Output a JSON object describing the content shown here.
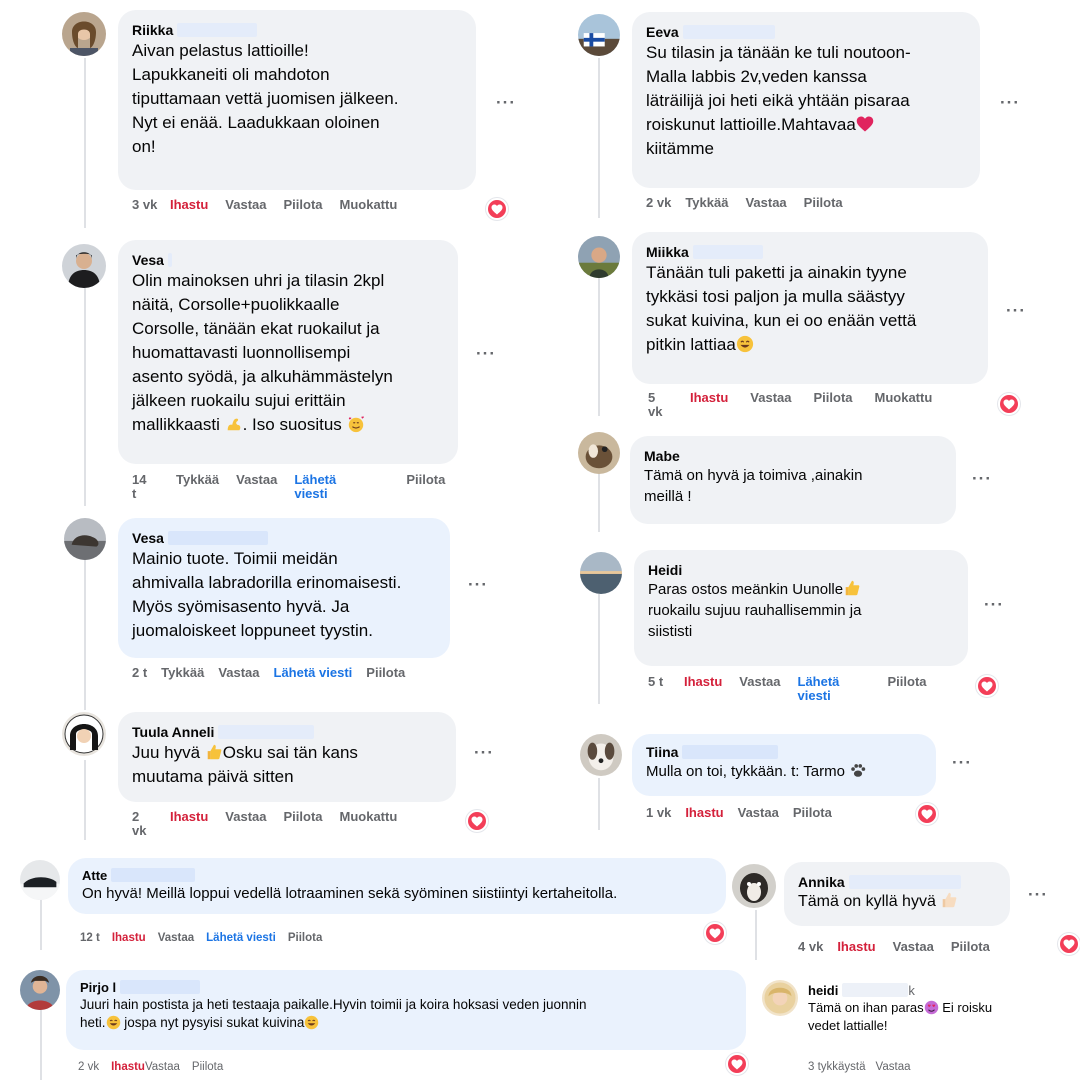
{
  "icons": {
    "more": "more-options-icon",
    "heart": "heart-reaction-icon"
  },
  "colors": {
    "love": "#d4213b",
    "link": "#1b74e4",
    "bubble_grey": "#f0f2f5",
    "bubble_blue": "#eaf2fd",
    "meta": "#65676b"
  },
  "more_label": "···",
  "comments": [
    {
      "name": "Riikka",
      "lines": [
        "Aivan pelastus lattioille!",
        "Lapukkaneiti oli mahdoton",
        "tiputtamaan vettä juomisen jälkeen.",
        "Nyt ei enää. Laadukkaan oloinen",
        "on!"
      ],
      "time": "3 vk",
      "like": "Ihastu",
      "reply": "Vastaa",
      "hide": "Piilota",
      "edited": "Muokattu"
    },
    {
      "name": "Vesa",
      "lines": [
        "Olin mainoksen uhri ja tilasin 2kpl",
        "näitä, Corsolle+puolikkaalle",
        "Corsolle, tänään ekat ruokailut ja",
        "huomattavasti luonnollisempi",
        "asento syödä, ja alkuhämmästelyn",
        "jälkeen ruokailu sujui erittäin",
        "mallikkaasti",
        ". Iso suositus"
      ],
      "time": "14 t",
      "like": "Tykkää",
      "reply": "Vastaa",
      "message": "Lähetä viesti",
      "hide": "Piilota"
    },
    {
      "name": "Vesa",
      "lines": [
        "Mainio tuote. Toimii meidän",
        "ahmivalla labradorilla erinomaisesti.",
        "Myös syömisasento hyvä. Ja",
        "juomaloiskeet loppuneet tyystin."
      ],
      "time": "2 t",
      "like": "Tykkää",
      "reply": "Vastaa",
      "message": "Lähetä viesti",
      "hide": "Piilota"
    },
    {
      "name": "Tuula Anneli",
      "lines": [
        "Juu hyvä",
        "Osku sai tän kans",
        "muutama päivä sitten"
      ],
      "time": "2 vk",
      "like": "Ihastu",
      "reply": "Vastaa",
      "hide": "Piilota",
      "edited": "Muokattu"
    },
    {
      "name": "Eeva",
      "lines": [
        "Su tilasin ja tänään ke tuli noutoon-",
        "Malla labbis 2v,veden kanssa",
        "läträilijä joi heti eikä yhtään pisaraa",
        "roiskunut lattioille.Mahtavaa",
        "kiitämme"
      ],
      "time": "2 vk",
      "like": "Tykkää",
      "reply": "Vastaa",
      "hide": "Piilota"
    },
    {
      "name": "Miikka",
      "lines": [
        "Tänään tuli paketti ja ainakin tyyne",
        "tykkäsi tosi paljon ja mulla säästyy",
        "sukat kuivina, kun ei oo enään vettä",
        "pitkin lattiaa"
      ],
      "time": "5 vk",
      "like": "Ihastu",
      "reply": "Vastaa",
      "hide": "Piilota",
      "edited": "Muokattu"
    },
    {
      "name": "Mabe",
      "lines": [
        "Tämä on hyvä ja toimiva ,ainakin",
        "meillä !"
      ]
    },
    {
      "name": "Heidi",
      "lines": [
        "Paras ostos meänkin Uunolle",
        "ruokailu sujuu rauhallisemmin ja",
        "siististi"
      ],
      "time": "5 t",
      "like": "Ihastu",
      "reply": "Vastaa",
      "message": "Lähetä viesti",
      "hide": "Piilota"
    },
    {
      "name": "Tiina",
      "lines": [
        "Mulla on toi, tykkään. t: Tarmo"
      ],
      "time": "1 vk",
      "like": "Ihastu",
      "reply": "Vastaa",
      "hide": "Piilota"
    },
    {
      "name": "Atte",
      "lines": [
        "On hyvä! Meillä loppui vedellä lotraaminen sekä syöminen siistiintyi kertaheitolla."
      ],
      "time": "12 t",
      "like": "Ihastu",
      "reply": "Vastaa",
      "message": "Lähetä viesti",
      "hide": "Piilota"
    },
    {
      "name": "Annika",
      "lines": [
        "Tämä on kyllä hyvä"
      ],
      "time": "4 vk",
      "like": "Ihastu",
      "reply": "Vastaa",
      "hide": "Piilota"
    },
    {
      "name": "Pirjo",
      "name_partial": "l",
      "lines": [
        "Juuri hain postista ja heti testaaja paikalle.Hyvin toimii ja koira hoksasi veden juonnin",
        "heti.",
        " jospa nyt pysyisi sukat kuivina"
      ],
      "time": "2 vk",
      "like": "Ihastu",
      "reply": "Vastaa",
      "hide": "Piilota"
    },
    {
      "name": "heidi",
      "name_partial": "k",
      "lines": [
        "Tämä on ihan paras",
        " Ei roisku",
        "vedet lattialle!"
      ],
      "meta": "3 tykkäystä",
      "reply": "Vastaa"
    }
  ]
}
